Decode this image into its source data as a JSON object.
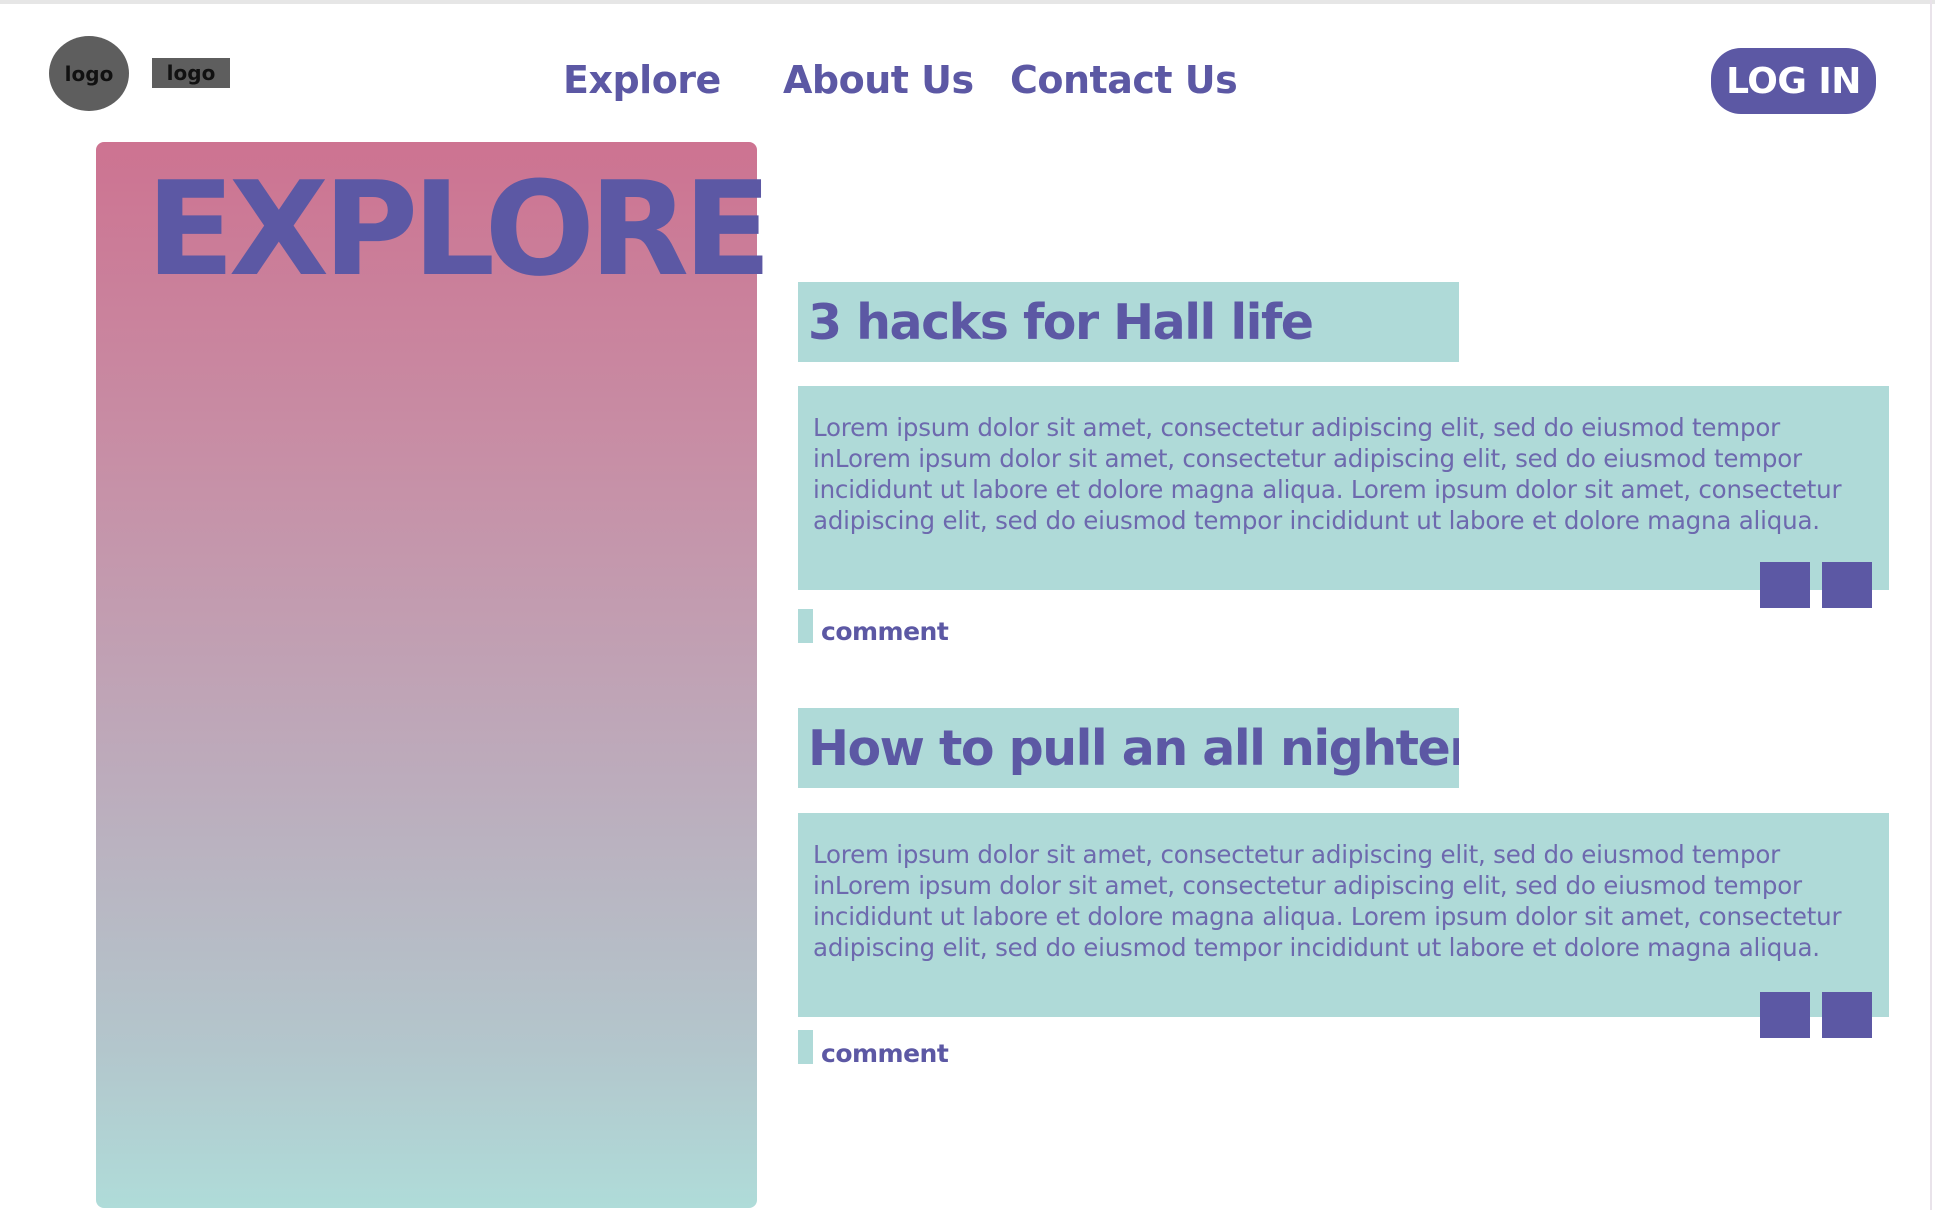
{
  "header": {
    "logo_circle": "logo",
    "logo_rect": "logo",
    "nav": {
      "explore": "Explore",
      "about": "About Us",
      "contact": "Contact Us"
    },
    "login_label": "LOG IN"
  },
  "hero": {
    "title": "EXPLORE"
  },
  "posts": [
    {
      "title": "3 hacks for Hall life",
      "body": "Lorem ipsum dolor sit amet, consectetur adipiscing elit, sed do eiusmod tempor inLorem ipsum dolor sit amet, consectetur adipiscing elit, sed do eiusmod tempor incididunt ut labore et dolore magna aliqua. Lorem ipsum dolor sit amet, consectetur adipiscing elit, sed do eiusmod tempor incididunt ut labore et dolore magna aliqua.",
      "comment_label": "comment"
    },
    {
      "title": "How to pull an all nighter",
      "body": "Lorem ipsum dolor sit amet, consectetur adipiscing elit, sed do eiusmod tempor inLorem ipsum dolor sit amet, consectetur adipiscing elit, sed do eiusmod tempor incididunt ut labore et dolore magna aliqua. Lorem ipsum dolor sit amet, consectetur adipiscing elit, sed do eiusmod tempor incididunt ut labore et dolore magna aliqua.",
      "comment_label": "comment"
    }
  ],
  "colors": {
    "brand_purple": "#5c58a4",
    "teal": "#afdad8",
    "pink": "#cd7391",
    "logo_gray": "#5e5e5e"
  }
}
